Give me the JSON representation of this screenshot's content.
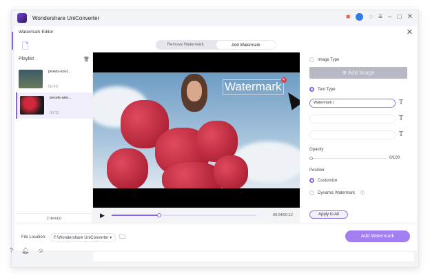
{
  "app": {
    "title": "Wondershare UniConverter"
  },
  "editor": {
    "title": "Watermark Editor",
    "tabs": [
      "Remove Watermark",
      "Add Watermark"
    ],
    "active_tab": "Add Watermark"
  },
  "playlist": {
    "label": "Playlist",
    "items": [
      {
        "name": "pexels-kool...",
        "duration": "00:40"
      },
      {
        "name": "pexels-arte...",
        "duration": "00:12",
        "selected": true
      }
    ],
    "count": "2 item(s)"
  },
  "video": {
    "watermark_text": "Watermark",
    "time": "00:04/00:12",
    "progress": 0.33
  },
  "panel": {
    "image_type": "Image Type",
    "add_image": "Add Image",
    "text_type": "Text Type",
    "text_inputs": [
      "Watermark |",
      "",
      ""
    ],
    "opacity_label": "Opacity",
    "opacity_value": "0/100",
    "opacity": 0,
    "position_label": "Position:",
    "customize": "Customize",
    "dynamic": "Dynamic Watermark",
    "apply_all": "Apply to All"
  },
  "footer": {
    "file_location_label": "File Location:",
    "file_location": "F:\\Wondershare UniConverter",
    "add_watermark": "Add Watermark"
  },
  "colors": {
    "accent": "#8a60ea",
    "button": "#a27ef0"
  }
}
